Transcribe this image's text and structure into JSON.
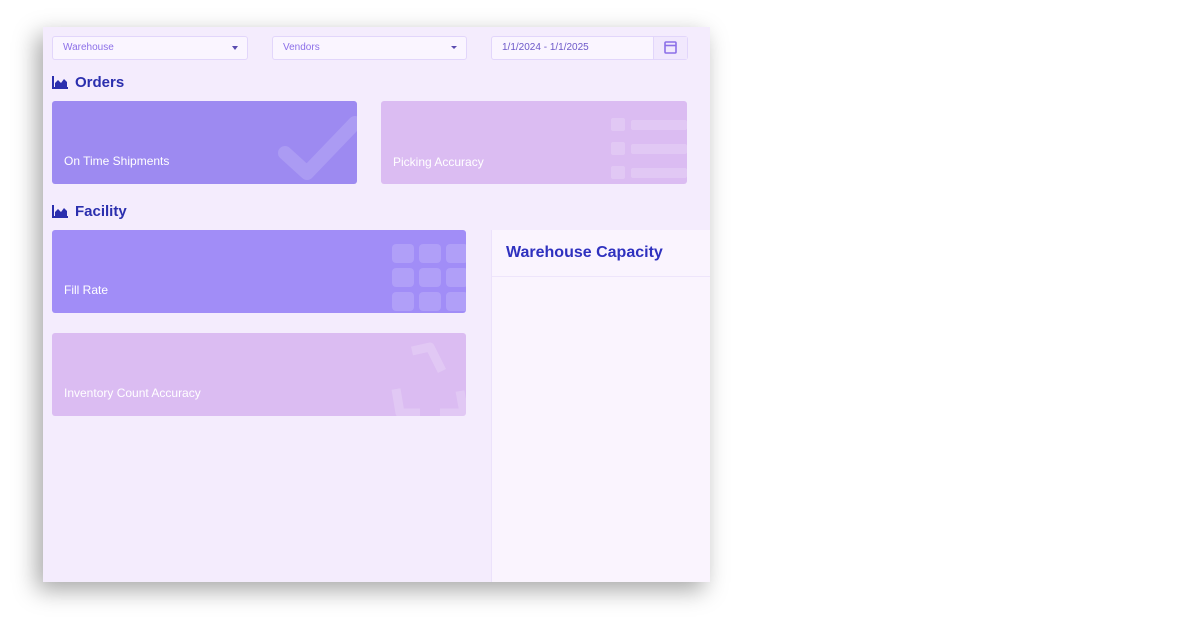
{
  "filters": {
    "warehouse": {
      "value": "Warehouse"
    },
    "vendors": {
      "value": "Vendors"
    },
    "date_range": {
      "value": "1/1/2024 - 1/1/2025",
      "icon": "calendar-icon"
    }
  },
  "sections": {
    "orders": {
      "title": "Orders",
      "icon": "area-chart-icon"
    },
    "facility": {
      "title": "Facility",
      "icon": "area-chart-icon"
    }
  },
  "cards": {
    "on_time": {
      "label": "On Time Shipments",
      "icon": "check-icon",
      "color": "#9d8af1"
    },
    "picking": {
      "label": "Picking Accuracy",
      "icon": "list-icon",
      "color": "#dbbcf2"
    },
    "fill_rate": {
      "label": "Fill Rate",
      "icon": "grid-icon",
      "color": "#a18df7"
    },
    "inventory": {
      "label": "Inventory Count Accuracy",
      "icon": "recycle-icon",
      "color": "#dbbcf2"
    }
  },
  "warehouse_capacity": {
    "title": "Warehouse Capacity"
  }
}
